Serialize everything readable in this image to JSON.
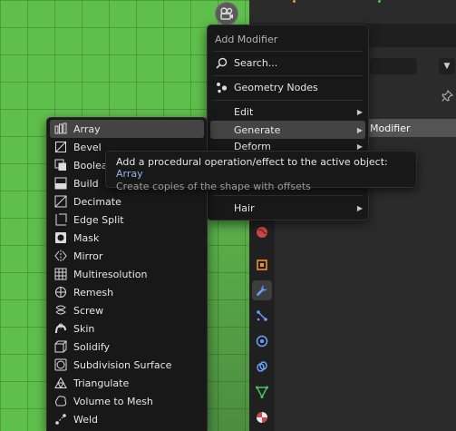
{
  "add_modifier_menu": {
    "title": "Add Modifier",
    "search_label": "Search...",
    "geometry_nodes_label": "Geometry Nodes",
    "edit_label": "Edit",
    "generate_label": "Generate",
    "deform_label": "Deform",
    "hair_label": "Hair"
  },
  "properties": {
    "add_modifier_button_label": "Modifier"
  },
  "tooltip": {
    "description": "Add a procedural operation/effect to the active object: ",
    "highlight": "Array",
    "detail": "Create copies of the shape with offsets"
  },
  "generate_menu": {
    "items": [
      {
        "label": "Array",
        "icon": "array-icon"
      },
      {
        "label": "Bevel",
        "icon": "bevel-icon"
      },
      {
        "label": "Boolea",
        "icon": "boolean-icon"
      },
      {
        "label": "Build",
        "icon": "build-icon"
      },
      {
        "label": "Decimate",
        "icon": "decimate-icon"
      },
      {
        "label": "Edge Split",
        "icon": "edge-split-icon"
      },
      {
        "label": "Mask",
        "icon": "mask-icon"
      },
      {
        "label": "Mirror",
        "icon": "mirror-icon"
      },
      {
        "label": "Multiresolution",
        "icon": "multiresolution-icon"
      },
      {
        "label": "Remesh",
        "icon": "remesh-icon"
      },
      {
        "label": "Screw",
        "icon": "screw-icon"
      },
      {
        "label": "Skin",
        "icon": "skin-icon"
      },
      {
        "label": "Solidify",
        "icon": "solidify-icon"
      },
      {
        "label": "Subdivision Surface",
        "icon": "subdivision-surface-icon"
      },
      {
        "label": "Triangulate",
        "icon": "triangulate-icon"
      },
      {
        "label": "Volume to Mesh",
        "icon": "volume-to-mesh-icon"
      },
      {
        "label": "Weld",
        "icon": "weld-icon"
      }
    ]
  },
  "colors": {
    "viewport_green": "#5fbf4c",
    "menu_bg": "#181818",
    "highlight_bg": "#444444",
    "tooltip_accent": "#95b3e8",
    "wrench_blue": "#6aa0ff"
  }
}
